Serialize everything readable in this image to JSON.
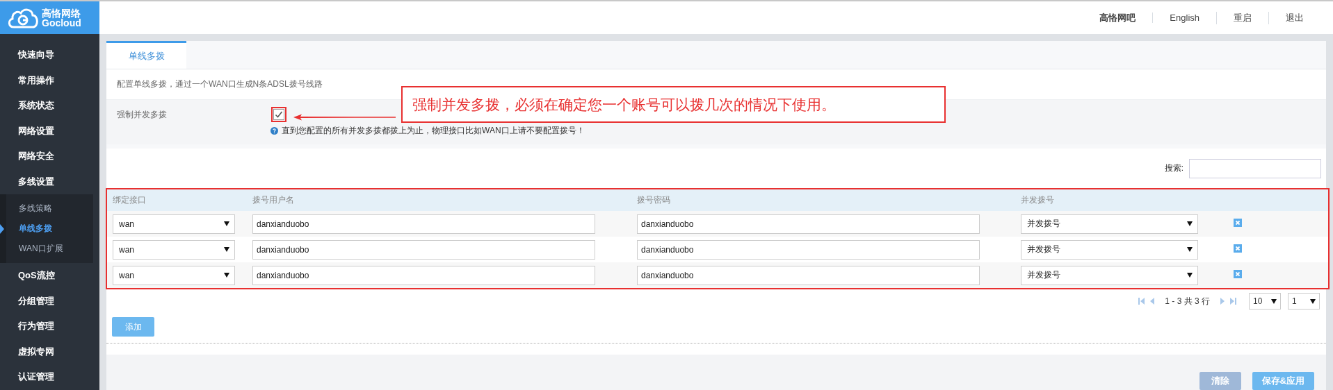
{
  "header": {
    "logo": {
      "name": "高恪网络",
      "sub": "Gocloud"
    },
    "links": [
      {
        "label": "高恪网吧",
        "kind": "account"
      },
      {
        "label": "English",
        "kind": "link"
      },
      {
        "label": "重启",
        "kind": "link"
      },
      {
        "label": "退出",
        "kind": "link"
      }
    ]
  },
  "sidebar": {
    "items": [
      {
        "label": "快速向导"
      },
      {
        "label": "常用操作"
      },
      {
        "label": "系统状态"
      },
      {
        "label": "网络设置"
      },
      {
        "label": "网络安全"
      },
      {
        "label": "多线设置",
        "children": [
          {
            "label": "多线策略",
            "selected": false
          },
          {
            "label": "单线多拨",
            "selected": true
          },
          {
            "label": "WAN口扩展",
            "selected": false
          }
        ]
      },
      {
        "label": "QoS流控"
      },
      {
        "label": "分组管理"
      },
      {
        "label": "行为管理"
      },
      {
        "label": "虚拟专网"
      },
      {
        "label": "认证管理"
      }
    ]
  },
  "tabs": [
    {
      "label": "单线多拨",
      "selected": true
    }
  ],
  "description": "配置单线多拨，通过一个WAN口生成N条ADSL拨号线路",
  "form": {
    "label": "强制并发多拨",
    "checked": true,
    "hint": "直到您配置的所有并发多拨都拨上为止，物理接口比如WAN口上请不要配置拨号！"
  },
  "annotation": {
    "text": "强制并发多拨，必须在确定您一个账号可以拨几次的情况下使用。"
  },
  "search": {
    "label": "搜索:"
  },
  "table": {
    "columns": [
      "绑定接口",
      "拨号用户名",
      "拨号密码",
      "并发拨号"
    ],
    "rows": [
      {
        "interface": "wan",
        "username": "danxianduobo",
        "password": "danxianduobo",
        "mode": "并发拨号"
      },
      {
        "interface": "wan",
        "username": "danxianduobo",
        "password": "danxianduobo",
        "mode": "并发拨号"
      },
      {
        "interface": "wan",
        "username": "danxianduobo",
        "password": "danxianduobo",
        "mode": "并发拨号"
      }
    ]
  },
  "pagination": {
    "summary": "1 - 3 共 3 行",
    "page_size": "10",
    "page": "1"
  },
  "add_button": "添加",
  "footer_buttons": [
    {
      "label": "清除",
      "disabled": true
    },
    {
      "label": "保存&应用",
      "disabled": false
    }
  ]
}
